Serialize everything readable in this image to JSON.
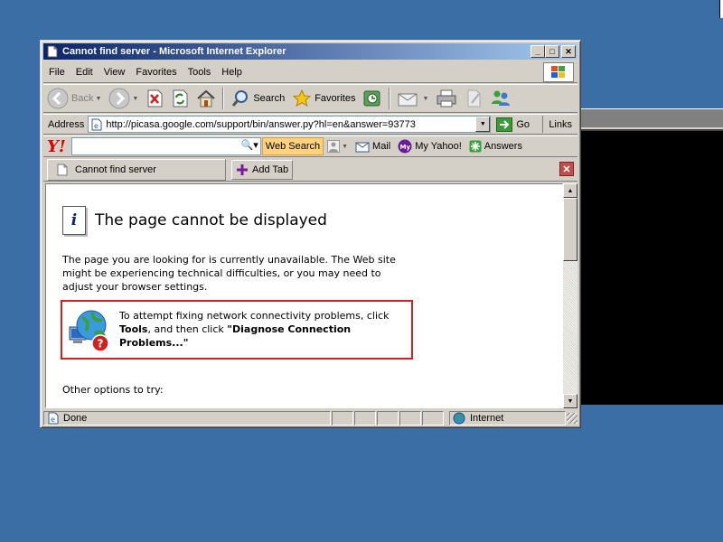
{
  "window": {
    "title": "Cannot find server - Microsoft Internet Explorer",
    "controls": {
      "minimize": "_",
      "maximize": "□",
      "close": "✕"
    }
  },
  "menu": [
    "File",
    "Edit",
    "View",
    "Favorites",
    "Tools",
    "Help"
  ],
  "toolbar": {
    "back_label": "Back",
    "search_label": "Search",
    "favorites_label": "Favorites"
  },
  "address": {
    "label": "Address",
    "url": "http://picasa.google.com/support/bin/answer.py?hl=en&answer=93773",
    "go_label": "Go",
    "links_label": "Links"
  },
  "yahoo": {
    "logo": "Y!",
    "search_value": "",
    "web_search_label": "Web Search",
    "mail_label": "Mail",
    "my_yahoo_label": "My Yahoo!",
    "answers_label": "Answers"
  },
  "tabs": {
    "active_tab_label": "Cannot find server",
    "add_tab_label": "Add Tab"
  },
  "page": {
    "heading": "The page cannot be displayed",
    "description": "The page you are looking for is currently unavailable. The Web site might be experiencing technical difficulties, or you may need to adjust your browser settings.",
    "diag_text_1": "To attempt fixing network connectivity problems, click ",
    "diag_tools": "Tools",
    "diag_text_2": ", and then click ",
    "diag_diagnose": "\"Diagnose Connection Problems...\"",
    "other_options": "Other options to try:"
  },
  "status": {
    "text": "Done",
    "zone": "Internet"
  },
  "colors": {
    "desktop": "#3a6ea5",
    "title_gradient_start": "#0a246a",
    "title_gradient_end": "#a6caf0",
    "diag_border": "#cc2222"
  }
}
